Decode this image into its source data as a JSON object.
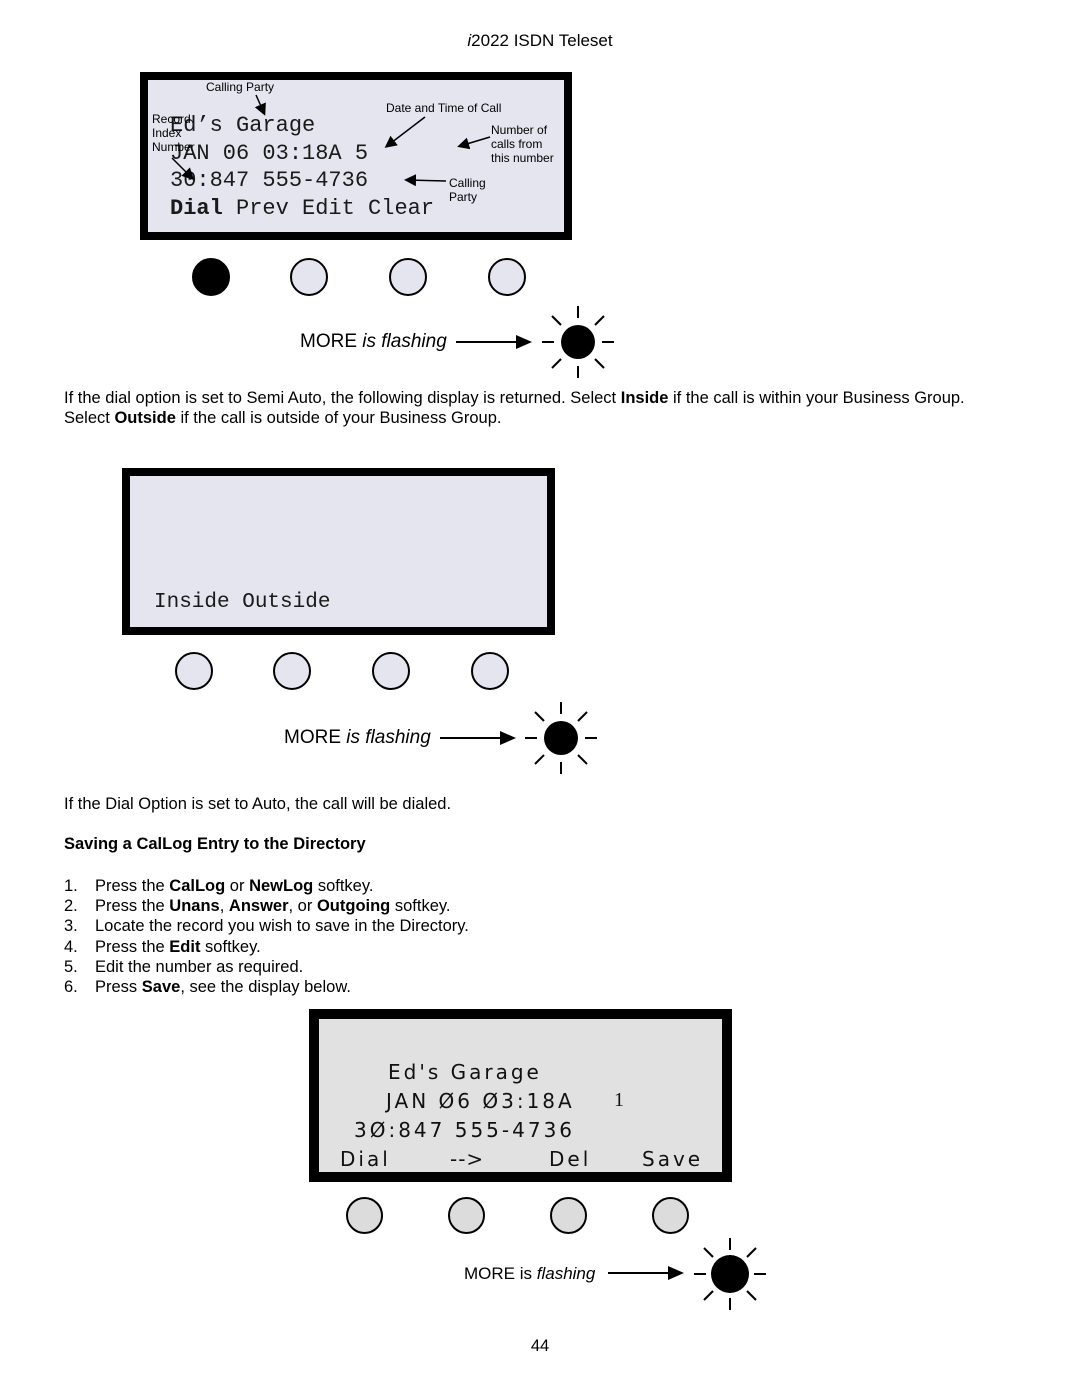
{
  "header": {
    "model_prefix": "i",
    "title_rest": "2022 ISDN Teleset"
  },
  "display1": {
    "lines": [
      "Ed’s Garage",
      "JAN 06 03:18A 5",
      "30:847 555-4736"
    ],
    "softkeys": [
      "Dial",
      "Prev",
      "Edit",
      "Clear"
    ],
    "annotations": {
      "calling_party_top": "Calling Party",
      "date_time": "Date and Time of Call",
      "record_index": [
        "Record",
        "Index",
        "Number"
      ],
      "num_calls": [
        "Number of",
        "calls from",
        "this number"
      ],
      "calling_party_right": [
        "Calling",
        "Party"
      ]
    },
    "active_key_index": 0
  },
  "more_flashing_1": {
    "word": "MORE",
    "rest": "is flashing"
  },
  "paragraph1": {
    "parts": [
      {
        "text": "If the dial option is set to Semi Auto, the following display is returned. Select ",
        "bold": false
      },
      {
        "text": "Inside",
        "bold": true
      },
      {
        "text": " if the call is within your Business Group. Select ",
        "bold": false
      },
      {
        "text": "Outside",
        "bold": true
      },
      {
        "text": " if the call is outside of your Business Group.",
        "bold": false
      }
    ]
  },
  "display2": {
    "softkeys_line": "Inside Outside"
  },
  "more_flashing_2": {
    "word": "MORE",
    "rest": "is flashing"
  },
  "paragraph2": "If the Dial Option is set to Auto, the call will be dialed.",
  "section_heading": "Saving a CalLog Entry to the Directory",
  "steps": [
    {
      "num": "1.",
      "parts": [
        {
          "t": "Press the ",
          "b": false
        },
        {
          "t": "CalLog",
          "b": true
        },
        {
          "t": " or ",
          "b": false
        },
        {
          "t": "NewLog",
          "b": true
        },
        {
          "t": " softkey.",
          "b": false
        }
      ]
    },
    {
      "num": "2.",
      "parts": [
        {
          "t": "Press the ",
          "b": false
        },
        {
          "t": "Unans",
          "b": true
        },
        {
          "t": ", ",
          "b": false
        },
        {
          "t": "Answer",
          "b": true
        },
        {
          "t": ", or ",
          "b": false
        },
        {
          "t": "Outgoing",
          "b": true
        },
        {
          "t": " softkey.",
          "b": false
        }
      ]
    },
    {
      "num": "3.",
      "parts": [
        {
          "t": "Locate the record you wish to save in the Directory.",
          "b": false
        }
      ]
    },
    {
      "num": "4.",
      "parts": [
        {
          "t": "Press the ",
          "b": false
        },
        {
          "t": "Edit",
          "b": true
        },
        {
          "t": " softkey.",
          "b": false
        }
      ]
    },
    {
      "num": "5.",
      "parts": [
        {
          "t": "Edit the number as required.",
          "b": false
        }
      ]
    },
    {
      "num": "6.",
      "parts": [
        {
          "t": "Press ",
          "b": false
        },
        {
          "t": "Save",
          "b": true
        },
        {
          "t": ", see the display below.",
          "b": false
        }
      ]
    }
  ],
  "display3": {
    "line1": "Ed's Garage",
    "line2_date": "JAN Ø6 Ø3:18A",
    "line2_count": "1",
    "line3": "3Ø:847 555-4736",
    "softkeys": [
      "Dial",
      "-->",
      "Del",
      "Save"
    ]
  },
  "more_flashing_3": {
    "word": "MORE is",
    "rest": "flashing"
  },
  "page_number": "44"
}
